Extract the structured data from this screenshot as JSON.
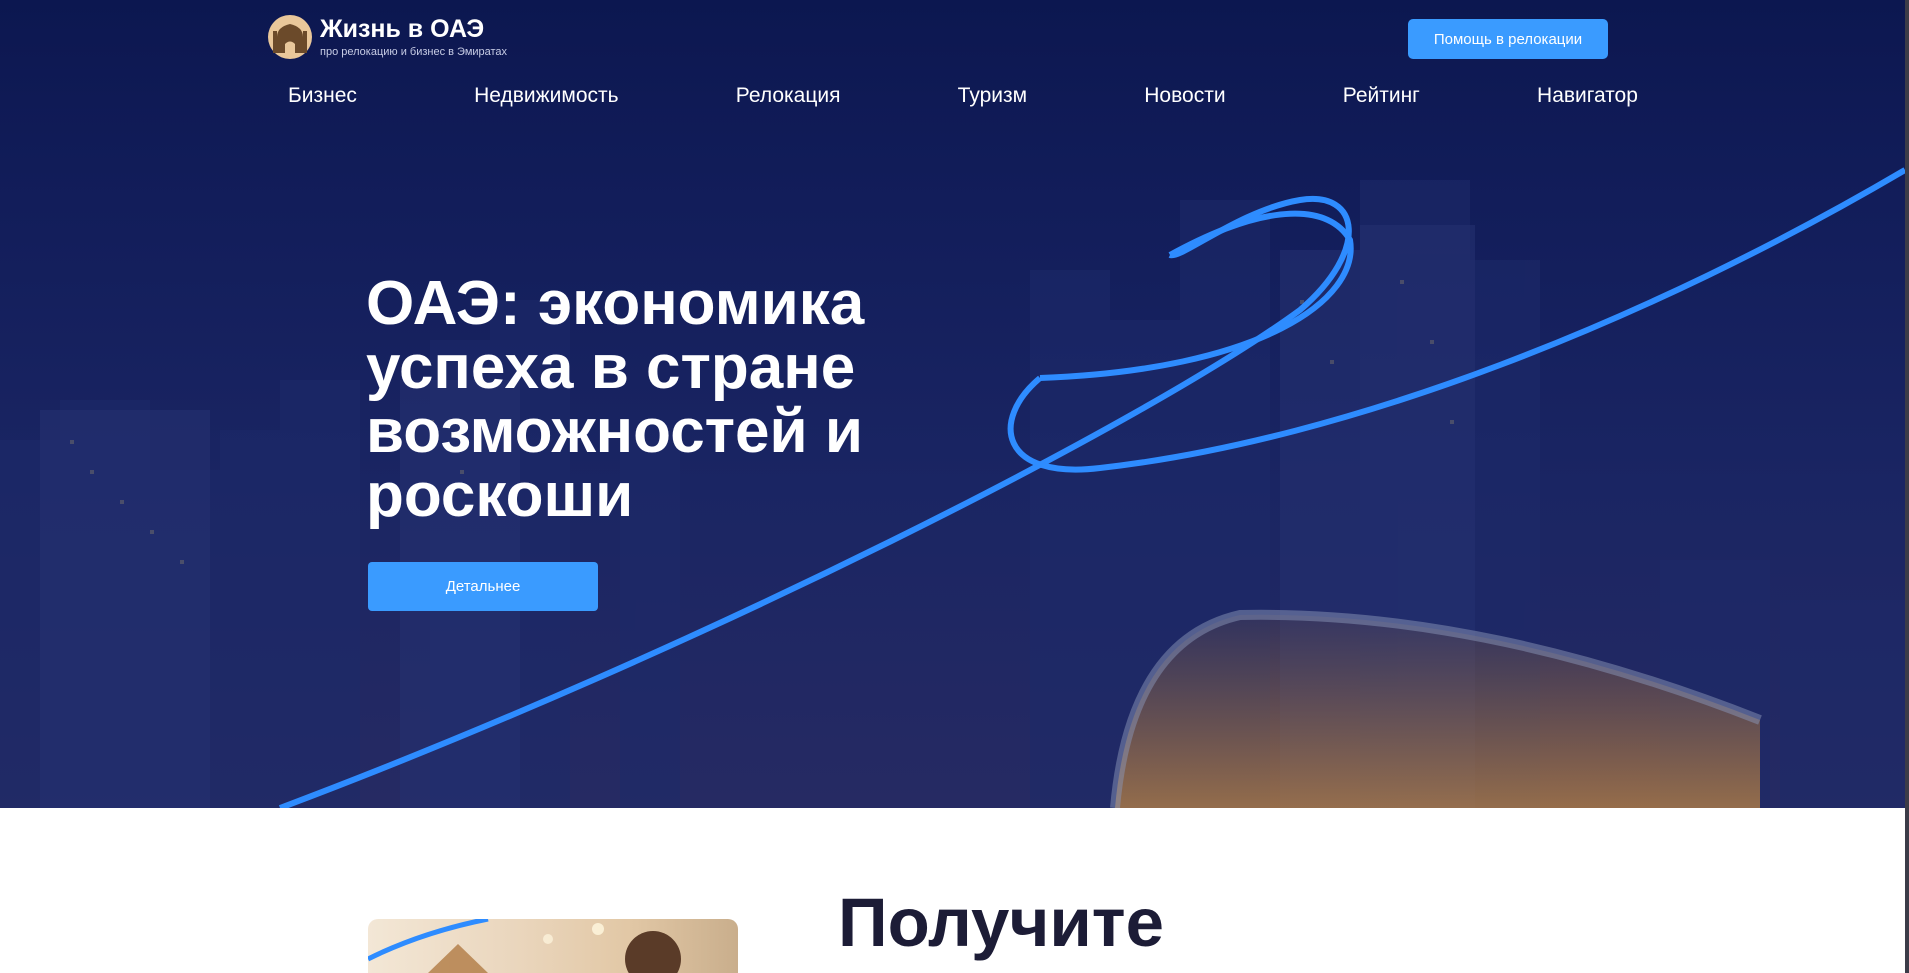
{
  "header": {
    "logo_title": "Жизнь в ОАЭ",
    "logo_subtitle": "про релокацию и бизнес в Эмиратах",
    "help_button": "Помощь в релокации"
  },
  "nav": {
    "items": [
      "Бизнес",
      "Недвижимость",
      "Релокация",
      "Туризм",
      "Новости",
      "Рейтинг",
      "Навигатор"
    ]
  },
  "hero": {
    "title": "ОАЭ: экономика успеха в стране возможностей и роскоши",
    "cta_label": "Детальнее"
  },
  "section": {
    "title": "Получите"
  },
  "colors": {
    "accent": "#3a9bff",
    "hero_bg": "#121d5a",
    "heading_dark": "#1c1c36"
  }
}
